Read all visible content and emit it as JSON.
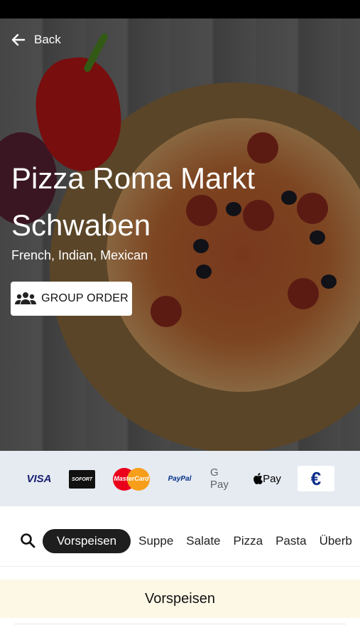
{
  "header": {
    "back_label": "Back"
  },
  "restaurant": {
    "name": "Pizza Roma Markt Schwaben",
    "cuisines": "French, Indian, Mexican",
    "group_order_label": "GROUP ORDER"
  },
  "payments": {
    "visa": "VISA",
    "sofort": "SOFORT",
    "mastercard": "MasterCard",
    "paypal": "PayPal",
    "gpay": "G Pay",
    "applepay": "Pay",
    "cash": "€"
  },
  "categories": {
    "tabs": [
      "Vorspeisen",
      "Suppe",
      "Salate",
      "Pizza",
      "Pasta",
      "Überb"
    ],
    "active": "Vorspeisen"
  },
  "menu": {
    "section_title": "Vorspeisen"
  },
  "icons": {
    "back": "arrow-left-icon",
    "group": "group-icon",
    "search": "search-icon"
  },
  "colors": {
    "active_tab_bg": "#1e1e1e",
    "payments_bg": "#e6ebf2",
    "section_bg": "#fdf8e6"
  }
}
